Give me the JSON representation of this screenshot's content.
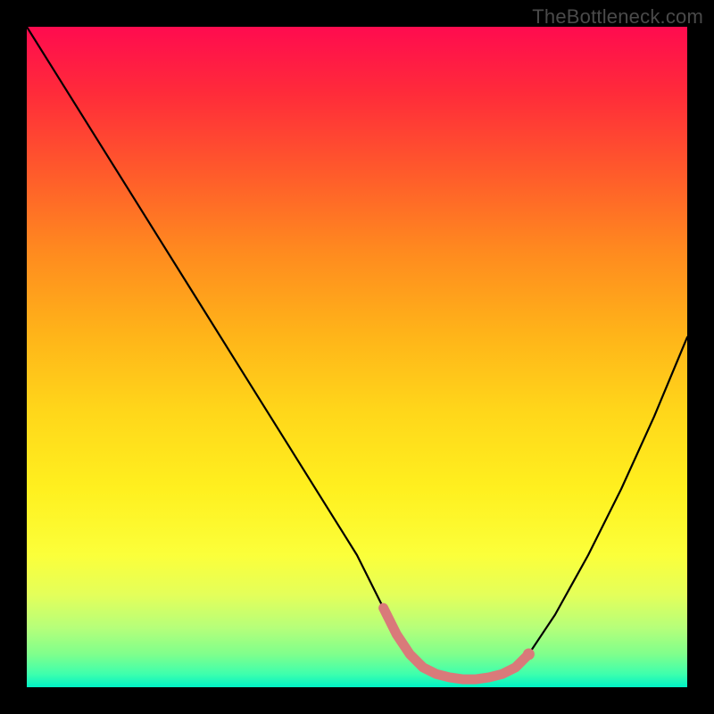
{
  "watermark": "TheBottleneck.com",
  "chart_data": {
    "type": "line",
    "title": "",
    "xlabel": "",
    "ylabel": "",
    "xlim": [
      0,
      100
    ],
    "ylim": [
      0,
      100
    ],
    "x": [
      0,
      5,
      10,
      15,
      20,
      25,
      30,
      35,
      40,
      45,
      50,
      52,
      54,
      56,
      58,
      60,
      62,
      64,
      66,
      68,
      70,
      72,
      74,
      76,
      78,
      80,
      85,
      90,
      95,
      100
    ],
    "values": [
      100,
      92,
      84,
      76,
      68,
      60,
      52,
      44,
      36,
      28,
      20,
      16,
      12,
      8,
      5,
      3,
      2,
      1.5,
      1.2,
      1.2,
      1.5,
      2,
      3,
      5,
      8,
      11,
      20,
      30,
      41,
      53
    ],
    "highlight": {
      "x_start": 54,
      "x_end": 76,
      "color": "#d97a7a",
      "marker_x": [
        76
      ],
      "marker_y": [
        5
      ]
    },
    "colors": {
      "gradient_top": "#ff0b4f",
      "gradient_mid": "#ffd61a",
      "gradient_bottom": "#00f2c5",
      "line": "#000000",
      "highlight_stroke": "#d97a7a"
    }
  }
}
